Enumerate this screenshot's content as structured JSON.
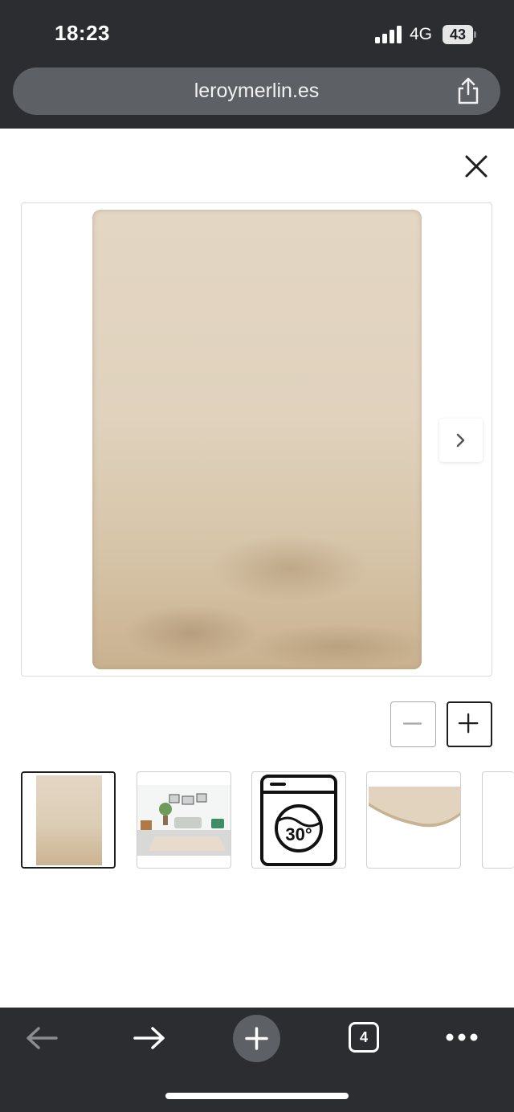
{
  "status_bar": {
    "time": "18:23",
    "network": "4G",
    "battery": "43"
  },
  "browser": {
    "url": "leroymerlin.es",
    "tab_count": "4"
  },
  "gallery": {
    "thumbnails": [
      {
        "name": "rug-front",
        "selected": true
      },
      {
        "name": "room-scene",
        "selected": false
      },
      {
        "name": "wash-30-icon",
        "selected": false
      },
      {
        "name": "rug-edge",
        "selected": false
      },
      {
        "name": "more",
        "selected": false
      }
    ],
    "wash_label": "30°"
  },
  "colors": {
    "chrome": "#2b2d30",
    "url_bar": "#5d6064",
    "rug": "#e0d2bd"
  }
}
